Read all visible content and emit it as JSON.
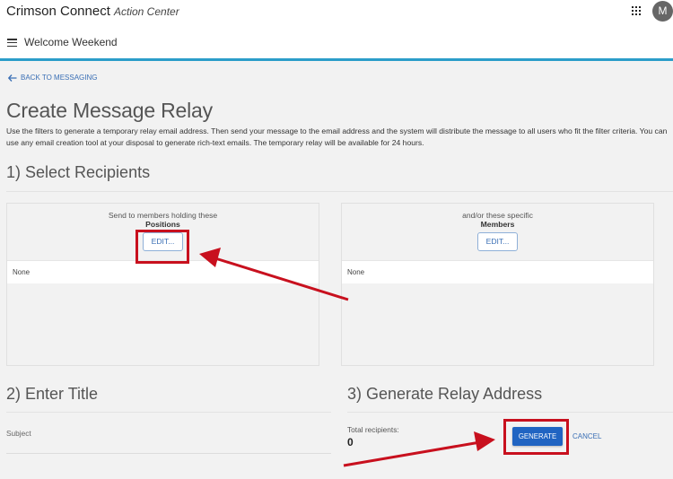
{
  "header": {
    "app_title": "Crimson Connect",
    "app_subtitle": "Action Center",
    "avatar_initial": "M",
    "org_name": "Welcome Weekend"
  },
  "nav": {
    "back_label": "BACK TO MESSAGING"
  },
  "page": {
    "title": "Create Message Relay",
    "description": "Use the filters to generate a temporary relay email address. Then send your message to the email address and the system will distribute the message to all users who fit the filter criteria. You can use any email creation tool at your disposal to generate rich-text emails. The temporary relay will be available for 24 hours."
  },
  "step1": {
    "title": "1) Select Recipients",
    "positions": {
      "line1": "Send to members holding these",
      "line2": "Positions",
      "edit_label": "EDIT...",
      "value": "None"
    },
    "members": {
      "line1": "and/or these specific",
      "line2": "Members",
      "edit_label": "EDIT...",
      "value": "None"
    }
  },
  "step2": {
    "title": "2) Enter Title",
    "subject_label": "Subject",
    "subject_value": ""
  },
  "step3": {
    "title": "3) Generate Relay Address",
    "total_label": "Total recipients:",
    "total_value": "0",
    "generate_label": "GENERATE",
    "cancel_label": "CANCEL"
  },
  "colors": {
    "accent_blue": "#2064c2",
    "link_blue": "#3a6fb5",
    "header_rule": "#2b9dc9",
    "annotation_red": "#c8101e"
  }
}
